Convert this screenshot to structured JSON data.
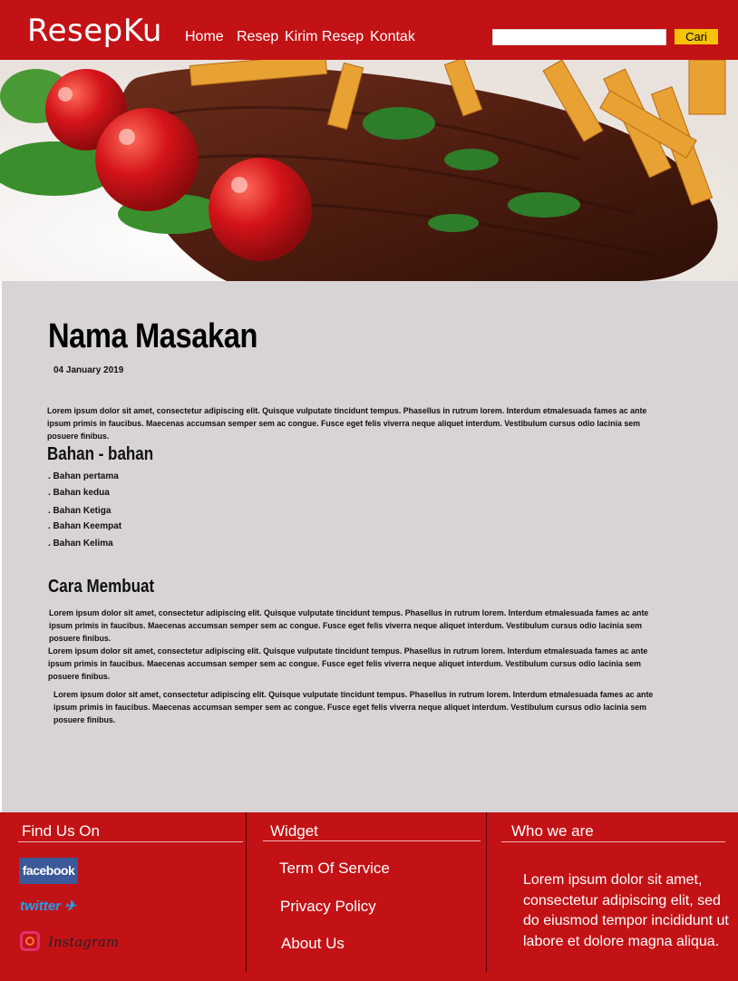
{
  "header": {
    "logo": "ResepKu",
    "nav": [
      "Home",
      "Resep",
      "Kirim Resep",
      "Kontak"
    ],
    "search": {
      "placeholder": "",
      "button": "Cari"
    }
  },
  "hero": {
    "alt": "steak-with-tomatoes-and-fries"
  },
  "article": {
    "title": "Nama Masakan",
    "date": "04 January 2019",
    "intro": "Lorem ipsum dolor sit amet, consectetur adipiscing elit. Quisque vulputate tincidunt tempus. Phasellus in rutrum lorem. Interdum etmalesuada fames ac ante ipsum primis in faucibus. Maecenas accumsan semper sem ac congue. Fusce eget felis viverra neque aliquet interdum. Vestibulum cursus odio lacinia sem posuere finibus.",
    "ingredients_heading": "Bahan - bahan",
    "ingredients": [
      ". Bahan pertama",
      ". Bahan kedua",
      ". Bahan Ketiga",
      ". Bahan Keempat",
      ". Bahan Kelima"
    ],
    "steps_heading": "Cara Membuat",
    "steps": [
      "Lorem ipsum dolor sit amet, consectetur adipiscing elit. Quisque vulputate tincidunt tempus. Phasellus in rutrum lorem. Interdum etmalesuada fames ac ante ipsum primis in faucibus. Maecenas accumsan semper sem ac congue. Fusce eget felis viverra neque aliquet interdum. Vestibulum cursus odio lacinia sem posuere finibus.",
      "Lorem ipsum dolor sit amet, consectetur adipiscing elit. Quisque vulputate tincidunt tempus. Phasellus in rutrum lorem. Interdum etmalesuada fames ac ante ipsum primis in faucibus. Maecenas accumsan semper sem ac congue. Fusce eget felis viverra neque aliquet interdum. Vestibulum cursus odio lacinia sem posuere finibus.",
      "Lorem ipsum dolor sit amet, consectetur adipiscing elit. Quisque vulputate tincidunt tempus. Phasellus in rutrum lorem. Interdum etmalesuada fames ac ante ipsum primis in faucibus. Maecenas accumsan semper sem ac congue. Fusce eget felis viverra neque aliquet interdum. Vestibulum cursus odio lacinia sem posuere finibus."
    ]
  },
  "footer": {
    "find_us": {
      "title": "Find Us On",
      "facebook": "facebook",
      "twitter": "twitter",
      "instagram": "Instagram"
    },
    "widget": {
      "title": "Widget",
      "links": [
        "Term Of Service",
        "Privacy Policy",
        "About Us"
      ]
    },
    "who": {
      "title": "Who we are",
      "text": "Lorem ipsum dolor sit amet, consectetur adipiscing elit, sed do eiusmod tempor incididunt ut labore et dolore magna aliqua."
    }
  },
  "colors": {
    "brand_red": "#c31216",
    "button_yellow": "#f5c409",
    "content_bg": "#d8d3d4"
  }
}
